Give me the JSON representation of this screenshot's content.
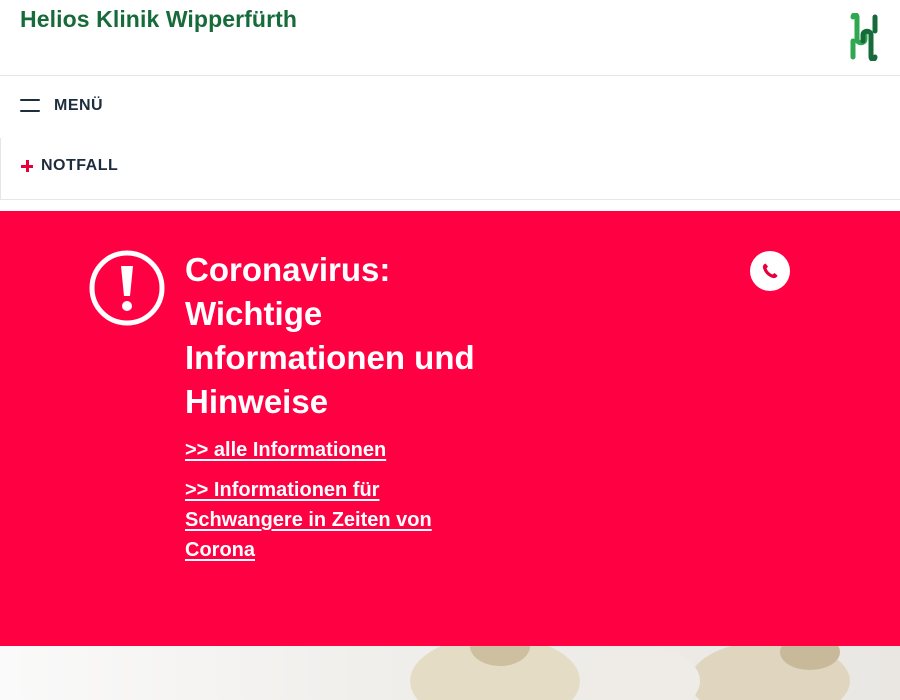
{
  "header": {
    "site_title": "Helios Klinik Wipperfürth",
    "logo_icon": "helios-logo-icon",
    "logo_colors": [
      "#2fa84f",
      "#176b3a"
    ]
  },
  "nav": {
    "menu_label": "MENÜ",
    "menu_icon": "hamburger-icon",
    "emergency_label": "NOTFALL",
    "emergency_icon": "plus-icon"
  },
  "alert": {
    "icon": "exclamation-circle-icon",
    "title": "Coronavirus: Wichtige Informationen und Hinweise",
    "links": [
      ">> alle Informationen",
      ">> Informationen für Schwangere in Zeiten von Corona"
    ],
    "phone_icon": "phone-icon",
    "background_color": "#ff0043"
  },
  "colors": {
    "brand_green": "#176b3a",
    "accent_red": "#e4003a",
    "text_dark": "#1e2d3d"
  }
}
